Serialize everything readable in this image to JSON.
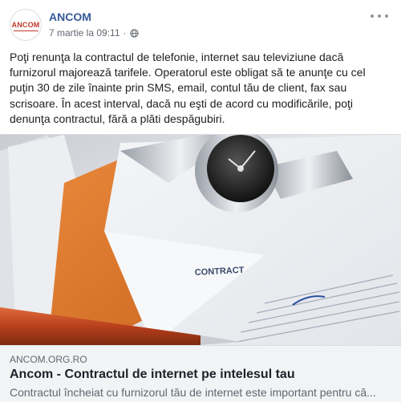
{
  "post": {
    "page_name": "ANCOM",
    "avatar_text": "ANCOM",
    "timestamp": "7 martie la 09:11",
    "separator": "·",
    "privacy_icon": "globe-icon",
    "more_icon": "more-options-icon",
    "text": "Poţi renunţa la contractul de telefonie, internet sau televiziune dacă furnizorul majorează tarifele. Operatorul este obligat să te anunţe cu cel puţin 30 de zile înainte prin SMS, email, contul tău de client, fax sau scrisoare. În acest interval, dacă nu eşti de acord cu modificările, poţi denunţa contractul, fără a plăti despăgubiri."
  },
  "link_preview": {
    "image_caption": "CONTRACT",
    "domain": "ANCOM.ORG.RO",
    "title": "Ancom - Contractul de internet pe intelesul tau",
    "description": "Contractul încheiat cu furnizorul tău de internet este important pentru că..."
  },
  "colors": {
    "page_name": "#365899",
    "meta_text": "#616770",
    "link_bg": "#f2f3f5",
    "brand_red": "#c0392b"
  }
}
